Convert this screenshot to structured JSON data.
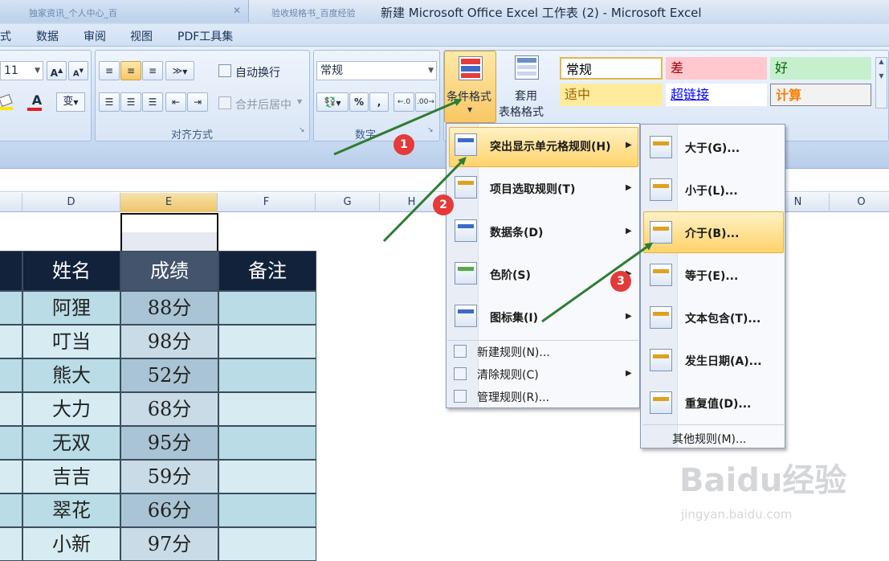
{
  "window": {
    "title": "新建 Microsoft Office Excel 工作表 (2) - Microsoft Excel",
    "ghost_tabs": [
      "独家资讯_个人中心_百度经验",
      "验收规格书_百度经验"
    ]
  },
  "menubar": [
    "式",
    "数据",
    "审阅",
    "视图",
    "PDF工具集"
  ],
  "ribbon": {
    "font_size": "11",
    "wrap_text": "自动换行",
    "merge_center": "合并后居中",
    "align_group": "对齐方式",
    "number_format": "常规",
    "number_group": "数字",
    "percent": "%",
    "comma": ",",
    "conditional_format": "条件格式",
    "table_format_1": "套用",
    "table_format_2": "表格格式",
    "styles": [
      {
        "label": "常规",
        "bg": "#ffffff",
        "color": "#000000"
      },
      {
        "label": "差",
        "bg": "#ffc7ce",
        "color": "#9c0006"
      },
      {
        "label": "好",
        "bg": "#c6efce",
        "color": "#006100"
      },
      {
        "label": "适中",
        "bg": "#ffeb9c",
        "color": "#9c6500"
      },
      {
        "label": "超链接",
        "bg": "#ffffff",
        "color": "#0000ff"
      },
      {
        "label": "计算",
        "bg": "#f2f2f2",
        "color": "#fa7d00"
      }
    ]
  },
  "columns": [
    "D",
    "E",
    "F",
    "G",
    "H",
    "N",
    "O"
  ],
  "table": {
    "headers": [
      "姓名",
      "成绩",
      "备注"
    ],
    "rows": [
      [
        "阿狸",
        "88分",
        ""
      ],
      [
        "叮当",
        "98分",
        ""
      ],
      [
        "熊大",
        "52分",
        ""
      ],
      [
        "大力",
        "68分",
        ""
      ],
      [
        "无双",
        "95分",
        ""
      ],
      [
        "吉吉",
        "59分",
        ""
      ],
      [
        "翠花",
        "66分",
        ""
      ],
      [
        "小新",
        "97分",
        ""
      ]
    ]
  },
  "cf_menu": {
    "items": [
      "突出显示单元格规则(H)",
      "项目选取规则(T)",
      "数据条(D)",
      "色阶(S)",
      "图标集(I)"
    ],
    "sub_items": [
      "新建规则(N)...",
      "清除规则(C)",
      "管理规则(R)..."
    ]
  },
  "highlight_menu": {
    "items": [
      "大于(G)...",
      "小于(L)...",
      "介于(B)...",
      "等于(E)...",
      "文本包含(T)...",
      "发生日期(A)...",
      "重复值(D)..."
    ],
    "more": "其他规则(M)..."
  },
  "badges": [
    "1",
    "2",
    "3"
  ],
  "watermark": {
    "brand": "Baidu经验",
    "url": "jingyan.baidu.com"
  },
  "colors": {
    "accent": "#2e7d32",
    "highlight": "#ffd36a",
    "header_dark": "#13223b",
    "badge": "#e43a3a"
  }
}
